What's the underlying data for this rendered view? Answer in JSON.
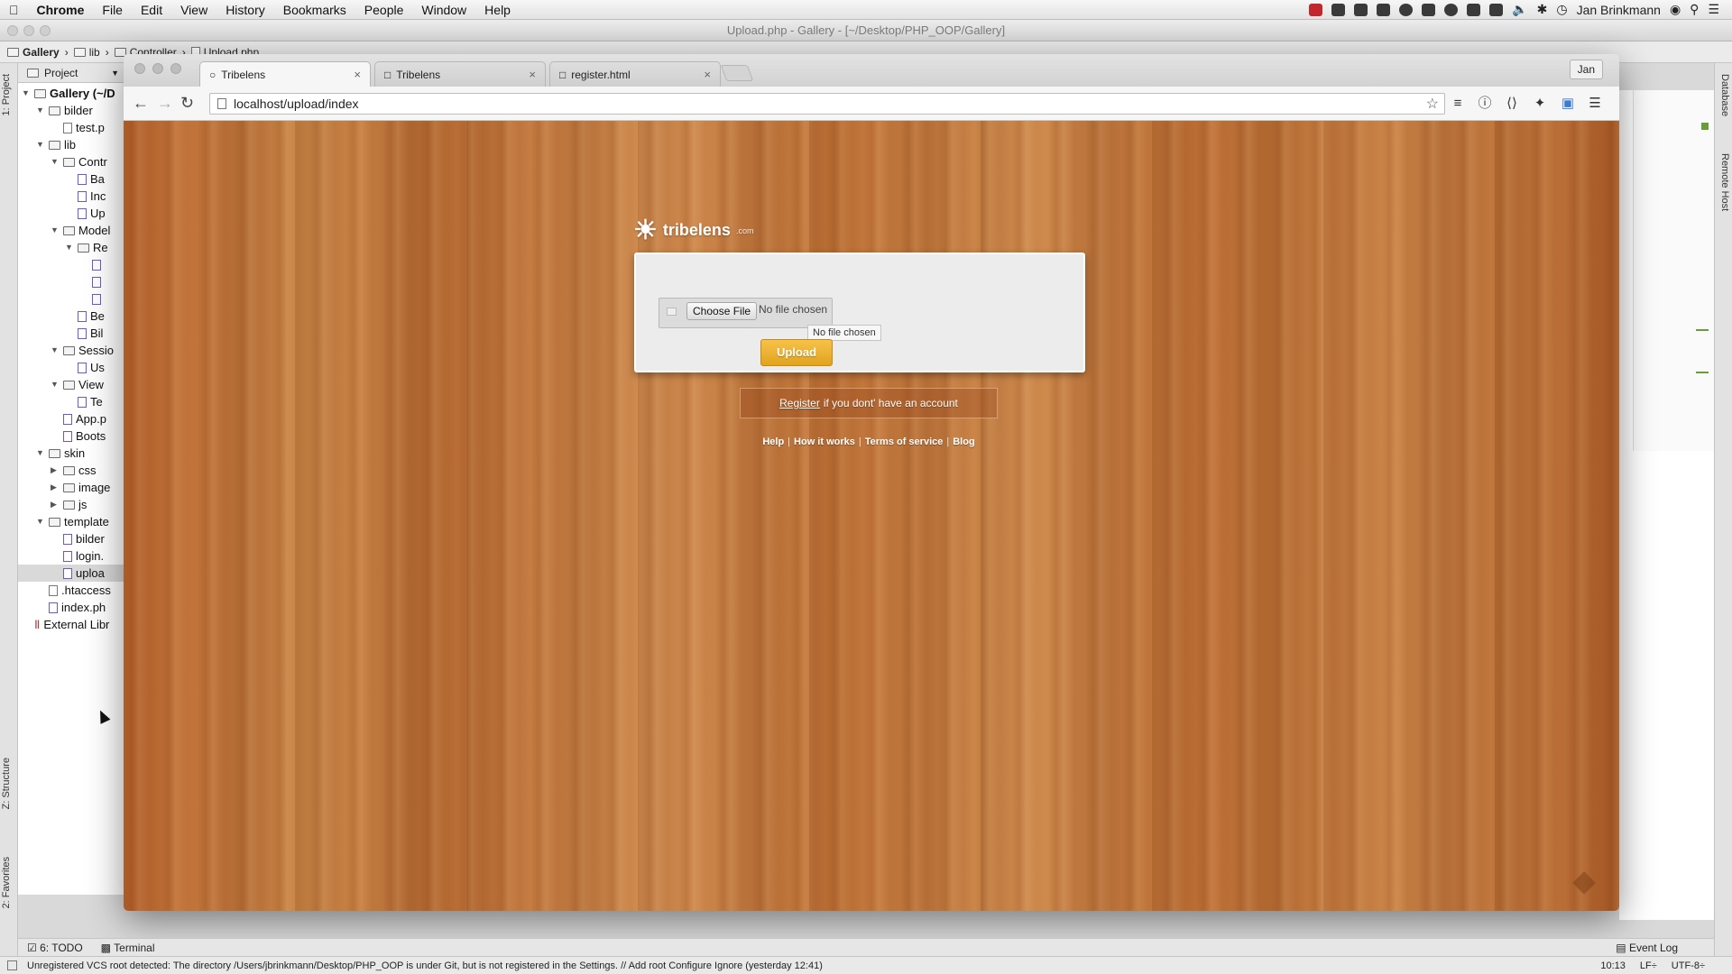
{
  "menubar": {
    "app": "Chrome",
    "items": [
      "File",
      "Edit",
      "View",
      "History",
      "Bookmarks",
      "People",
      "Window",
      "Help"
    ],
    "user": "Jan Brinkmann"
  },
  "ide": {
    "title": "Upload.php - Gallery - [~/Desktop/PHP_OOP/Gallery]",
    "breadcrumbs": [
      "Gallery",
      "lib",
      "Controller",
      "Upload.php"
    ],
    "left_tabs": {
      "project": "1: Project",
      "structure": "Z: Structure",
      "favorites": "2: Favorites"
    },
    "right_tabs": {
      "database": "Database",
      "remote_host": "Remote Host"
    },
    "project_header": "Project",
    "tree": [
      {
        "label": "Gallery (~/D",
        "depth": 0,
        "type": "folder",
        "open": true
      },
      {
        "label": "bilder",
        "depth": 1,
        "type": "folder",
        "open": true
      },
      {
        "label": "test.p",
        "depth": 2,
        "type": "file"
      },
      {
        "label": "lib",
        "depth": 1,
        "type": "folder",
        "open": true
      },
      {
        "label": "Contr",
        "depth": 2,
        "type": "folder",
        "open": true
      },
      {
        "label": "Ba",
        "depth": 3,
        "type": "php"
      },
      {
        "label": "Inc",
        "depth": 3,
        "type": "php"
      },
      {
        "label": "Up",
        "depth": 3,
        "type": "php"
      },
      {
        "label": "Model",
        "depth": 2,
        "type": "folder",
        "open": true
      },
      {
        "label": "Re",
        "depth": 3,
        "type": "folder",
        "open": true
      },
      {
        "label": "",
        "depth": 4,
        "type": "php"
      },
      {
        "label": "",
        "depth": 4,
        "type": "php"
      },
      {
        "label": "",
        "depth": 4,
        "type": "php"
      },
      {
        "label": "Be",
        "depth": 3,
        "type": "php"
      },
      {
        "label": "Bil",
        "depth": 3,
        "type": "php"
      },
      {
        "label": "Sessio",
        "depth": 2,
        "type": "folder",
        "open": true
      },
      {
        "label": "Us",
        "depth": 3,
        "type": "php"
      },
      {
        "label": "View",
        "depth": 2,
        "type": "folder",
        "open": true
      },
      {
        "label": "Te",
        "depth": 3,
        "type": "php"
      },
      {
        "label": "App.p",
        "depth": 2,
        "type": "php"
      },
      {
        "label": "Boots",
        "depth": 2,
        "type": "php"
      },
      {
        "label": "skin",
        "depth": 1,
        "type": "folder",
        "open": true
      },
      {
        "label": "css",
        "depth": 2,
        "type": "folder",
        "open": false
      },
      {
        "label": "image",
        "depth": 2,
        "type": "folder",
        "open": false
      },
      {
        "label": "js",
        "depth": 2,
        "type": "folder",
        "open": false
      },
      {
        "label": "template",
        "depth": 1,
        "type": "folder",
        "open": true
      },
      {
        "label": "bilder",
        "depth": 2,
        "type": "php"
      },
      {
        "label": "login.",
        "depth": 2,
        "type": "php"
      },
      {
        "label": "uploa",
        "depth": 2,
        "type": "php",
        "selected": true
      },
      {
        "label": ".htaccess",
        "depth": 1,
        "type": "file"
      },
      {
        "label": "index.ph",
        "depth": 1,
        "type": "php"
      },
      {
        "label": "External Libr",
        "depth": 0,
        "type": "lib"
      }
    ],
    "bottom_tabs": {
      "todo": "6: TODO",
      "terminal": "Terminal",
      "event_log": "Event Log"
    },
    "status_message": "Unregistered VCS root detected: The directory /Users/jbrinkmann/Desktop/PHP_OOP is under Git, but is not registered in the Settings. // Add root  Configure  Ignore (yesterday 12:41)",
    "status_right": {
      "position": "10:13",
      "line_sep": "LF÷",
      "encoding": "UTF-8÷"
    }
  },
  "browser": {
    "tabs": [
      {
        "label": "Tribelens",
        "active": true
      },
      {
        "label": "Tribelens",
        "active": false
      },
      {
        "label": "register.html",
        "active": false
      }
    ],
    "profile": "Jan",
    "url": "localhost/upload/index"
  },
  "page": {
    "logo_text": "tribelens",
    "logo_suffix": ".com",
    "choose_file": "Choose File",
    "no_file": "No file chosen",
    "tooltip": "No file chosen",
    "upload_button": "Upload",
    "register_link": "Register",
    "register_rest": "if you dont' have an account",
    "footer_links": [
      "Help",
      "How it works",
      "Terms of service",
      "Blog"
    ]
  },
  "colors": {
    "upload_button": "#e8aa28",
    "wood_base": "#c27a3e"
  }
}
